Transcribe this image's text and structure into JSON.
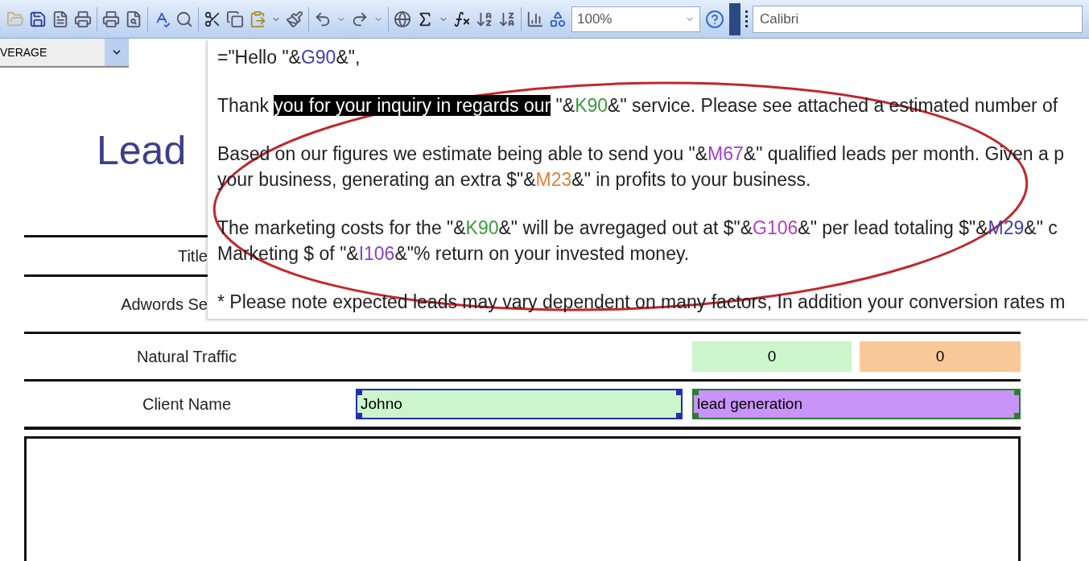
{
  "toolbar": {
    "zoom": "100%",
    "font": "Calibri"
  },
  "name_box": "VERAGE",
  "formula_popup": {
    "paragraphs": [
      {
        "lines": [
          [
            {
              "kind": "text",
              "text": "=\"Hello \"&"
            },
            {
              "kind": "ref",
              "text": "G90",
              "color": "#3b3fb0"
            },
            {
              "kind": "text",
              "text": "&\","
            }
          ]
        ]
      },
      {
        "lines": [
          [
            {
              "kind": "text",
              "text": "Thank "
            },
            {
              "kind": "selected",
              "text": "you for your inquiry in regards our"
            },
            {
              "kind": "text",
              "text": " \"&"
            },
            {
              "kind": "ref",
              "text": "K90",
              "color": "#3c9a3c"
            },
            {
              "kind": "text",
              "text": "&\" service. Please see attached a estimated number of"
            }
          ]
        ]
      },
      {
        "lines": [
          [
            {
              "kind": "text",
              "text": "Based on our figures we estimate being able to send you \"&"
            },
            {
              "kind": "ref",
              "text": "M67",
              "color": "#a040d0"
            },
            {
              "kind": "text",
              "text": "&\" qualified leads per month. Given a p"
            }
          ],
          [
            {
              "kind": "text",
              "text": "your business, generating an extra $\"&"
            },
            {
              "kind": "ref",
              "text": "M23",
              "color": "#e0803c"
            },
            {
              "kind": "text",
              "text": "&\" in profits to your business."
            }
          ]
        ]
      },
      {
        "lines": [
          [
            {
              "kind": "text",
              "text": "The marketing costs for the \"&"
            },
            {
              "kind": "ref",
              "text": "K90",
              "color": "#3c9a3c"
            },
            {
              "kind": "text",
              "text": "&\" will be avregaged out at $\"&"
            },
            {
              "kind": "ref",
              "text": "G106",
              "color": "#b040c0"
            },
            {
              "kind": "text",
              "text": "&\" per lead totaling $\"&"
            },
            {
              "kind": "ref",
              "text": "M29",
              "color": "#3b3fb0"
            },
            {
              "kind": "text",
              "text": "&\" c"
            }
          ],
          [
            {
              "kind": "text",
              "text": "Marketing $ of \"&"
            },
            {
              "kind": "ref",
              "text": "I106",
              "color": "#8a40c8"
            },
            {
              "kind": "text",
              "text": "&\"% return on your invested money."
            }
          ]
        ]
      },
      {
        "lines": [
          [
            {
              "kind": "text",
              "text": "* Please note expected leads may vary dependent on many factors, In addition your conversion rates m"
            }
          ]
        ]
      }
    ]
  },
  "sheet": {
    "heading": "Lead",
    "rows": [
      {
        "kind": "title",
        "label": "Title"
      },
      {
        "kind": "title",
        "label": "Adwords Se"
      },
      {
        "kind": "values",
        "label": "Natural Traffic",
        "cells": [
          {
            "value": "0",
            "color": "#ccf5cc"
          },
          {
            "value": "0",
            "color": "#f9c99a"
          }
        ]
      },
      {
        "kind": "inputs",
        "label": "Client Name",
        "cells": [
          {
            "value": "Johno",
            "color": "#ccf5cc",
            "selected": true
          },
          {
            "value": "lead generation",
            "color": "#c894f7",
            "selected": false
          }
        ]
      }
    ]
  }
}
